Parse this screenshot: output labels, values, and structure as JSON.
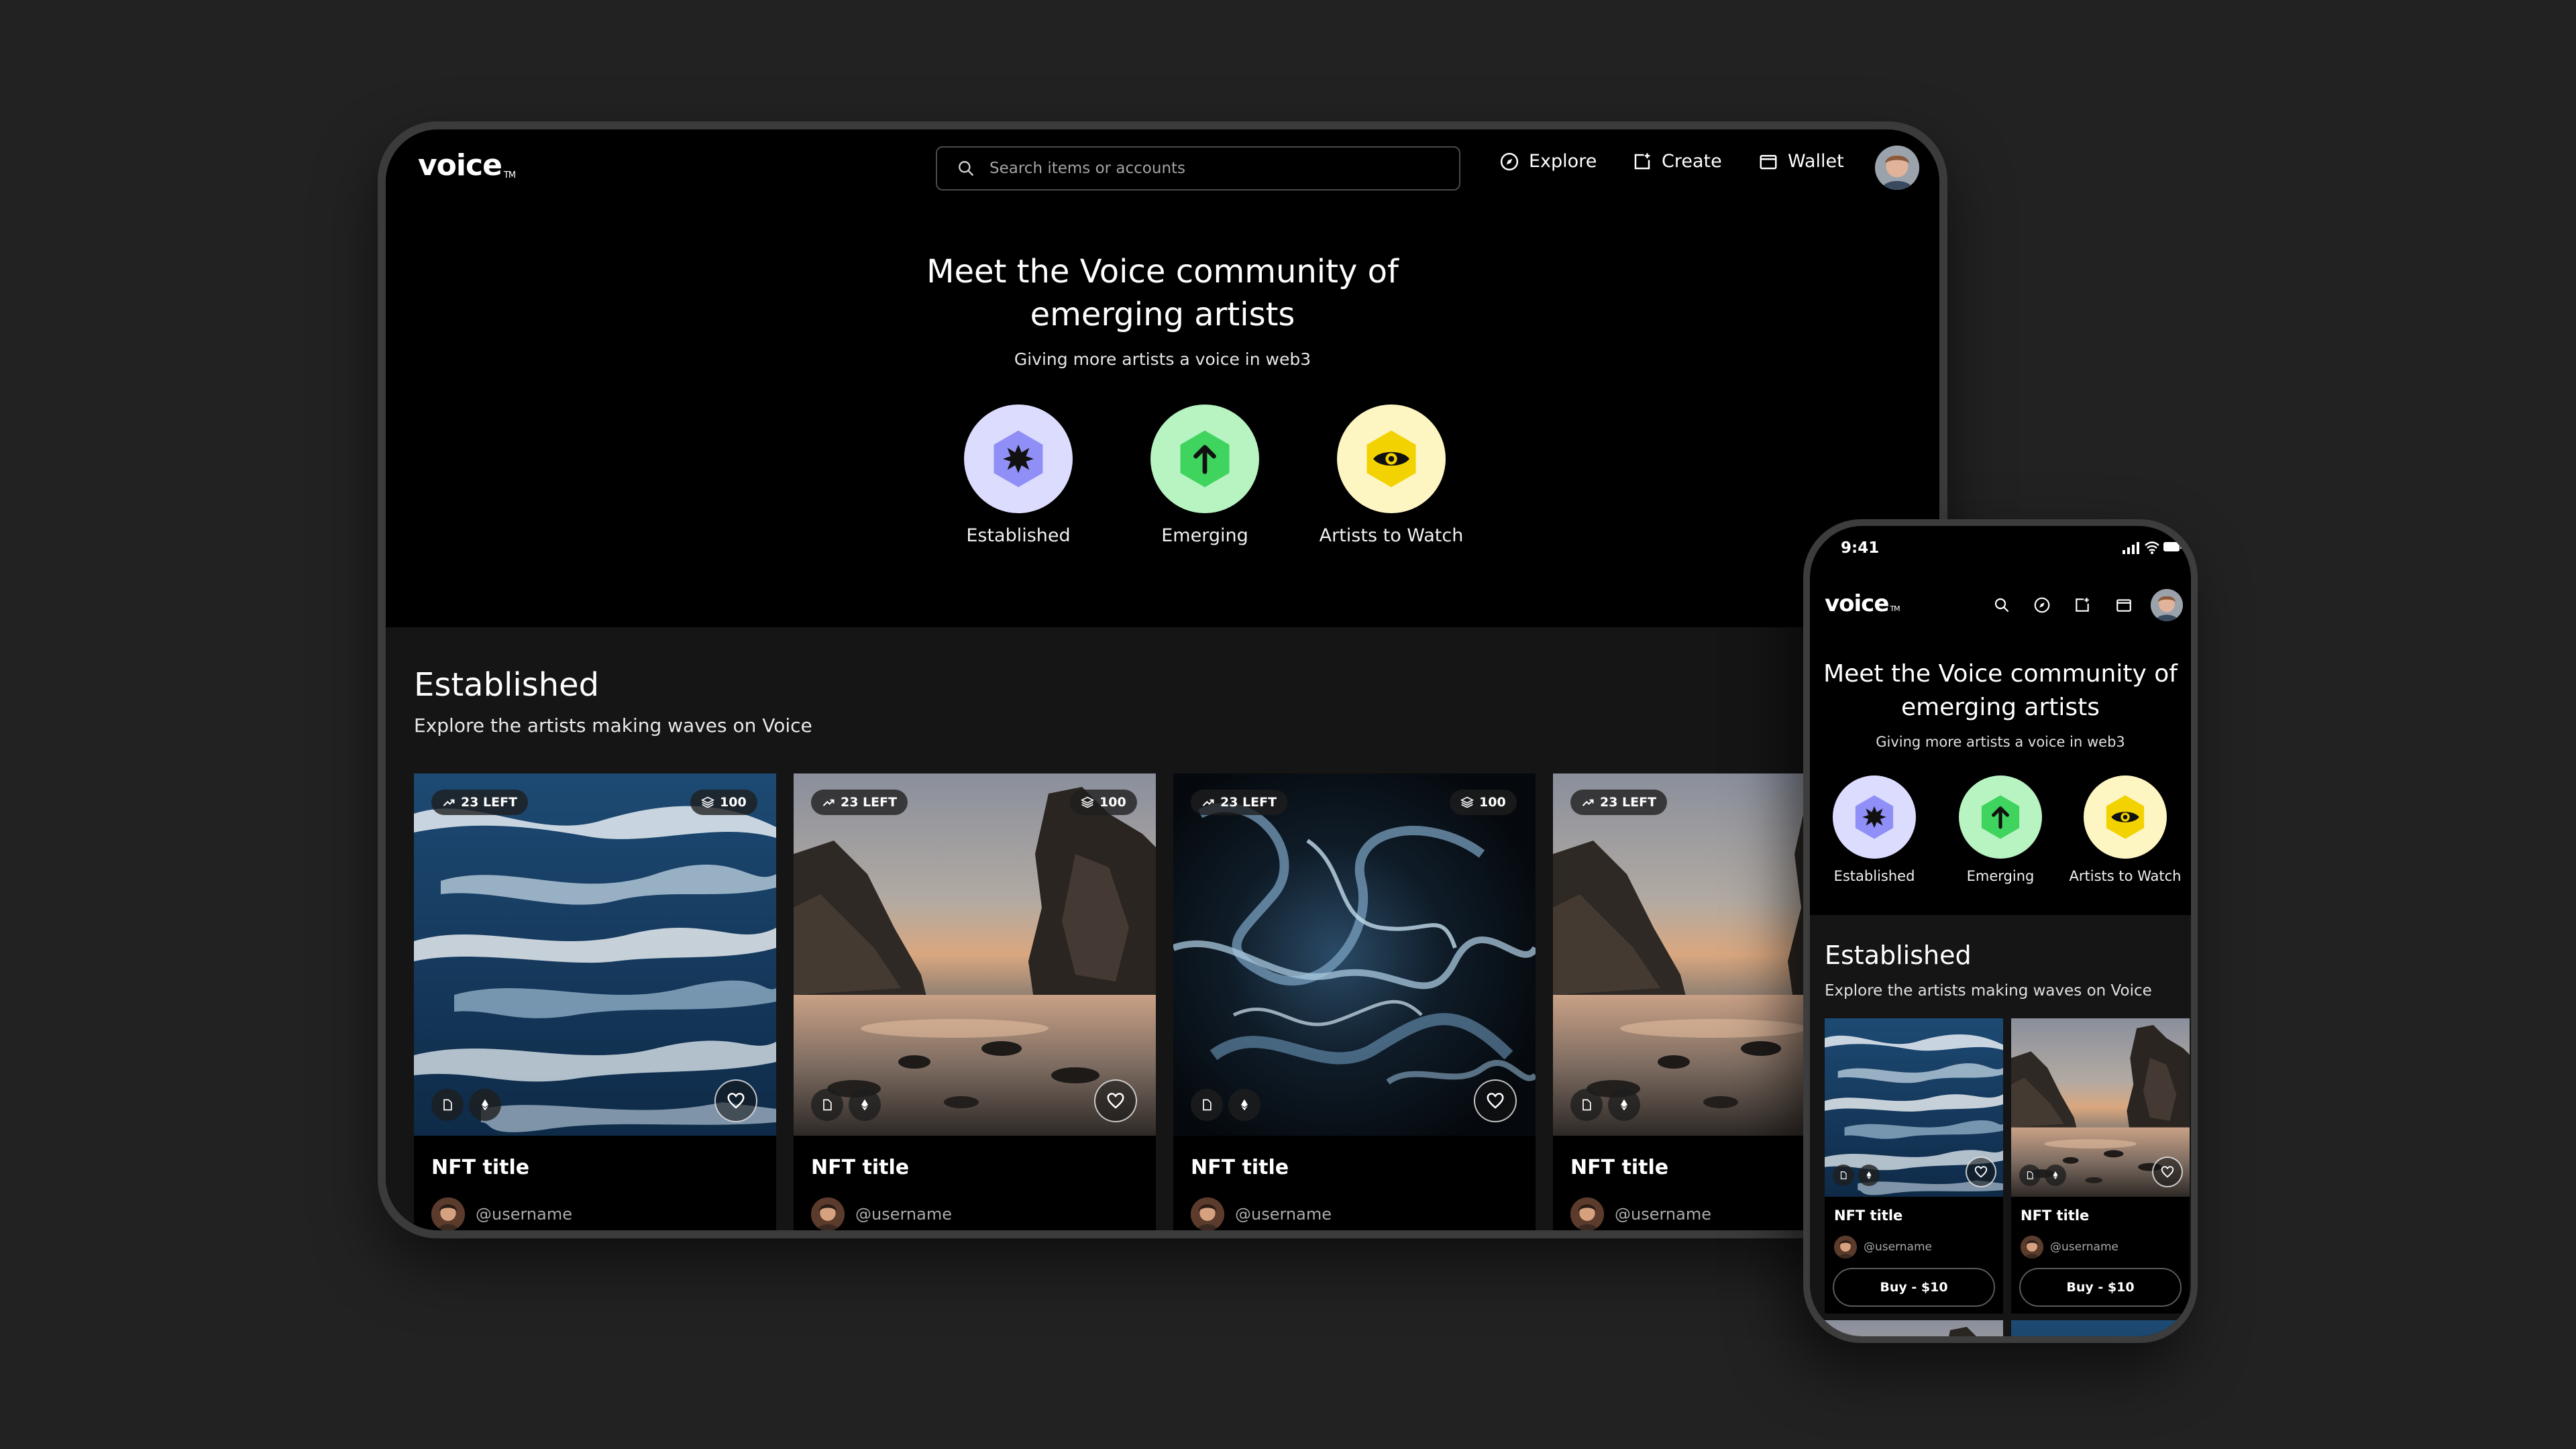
{
  "brand": {
    "name": "voice",
    "tm": "TM"
  },
  "search": {
    "placeholder": "Search items or accounts"
  },
  "nav": {
    "explore": "Explore",
    "create": "Create",
    "wallet": "Wallet"
  },
  "hero": {
    "title_line1": "Meet the Voice community of",
    "title_line2": "emerging artists",
    "subtitle": "Giving more artists a voice in web3"
  },
  "categories": [
    {
      "label": "Established",
      "icon": "star-burst-icon",
      "bg": "#dcdcff",
      "badge": "#8f8ff7"
    },
    {
      "label": "Emerging",
      "icon": "arrow-up-icon",
      "bg": "#b8f3c2",
      "badge": "#3fd45d"
    },
    {
      "label": "Artists to Watch",
      "icon": "eye-icon",
      "bg": "#fdf6c3",
      "badge": "#f2d200"
    }
  ],
  "section": {
    "title": "Established",
    "subtitle": "Explore the artists making waves on Voice"
  },
  "cards": [
    {
      "title": "NFT title",
      "username": "@username",
      "left": "23 LEFT",
      "count": "100",
      "art": "ocean-painting"
    },
    {
      "title": "NFT title",
      "username": "@username",
      "left": "23 LEFT",
      "count": "100",
      "art": "beach-cliffs"
    },
    {
      "title": "NFT title",
      "username": "@username",
      "left": "23 LEFT",
      "count": "100",
      "art": "marble-swirl"
    },
    {
      "title": "NFT title",
      "username": "@username",
      "left": "23 LEFT",
      "count": "",
      "art": "beach-cliffs"
    }
  ],
  "phone": {
    "time": "9:41",
    "hero": {
      "title_line1": "Meet the Voice community of",
      "title_line2": "emerging artists",
      "subtitle": "Giving more artists a voice in web3"
    },
    "section": {
      "title": "Established",
      "subtitle": "Explore the artists making waves on Voice"
    },
    "cards": [
      {
        "title": "NFT title",
        "username": "@username",
        "buy": "Buy - $10"
      },
      {
        "title": "NFT title",
        "username": "@username",
        "buy": "Buy - $10"
      }
    ]
  }
}
